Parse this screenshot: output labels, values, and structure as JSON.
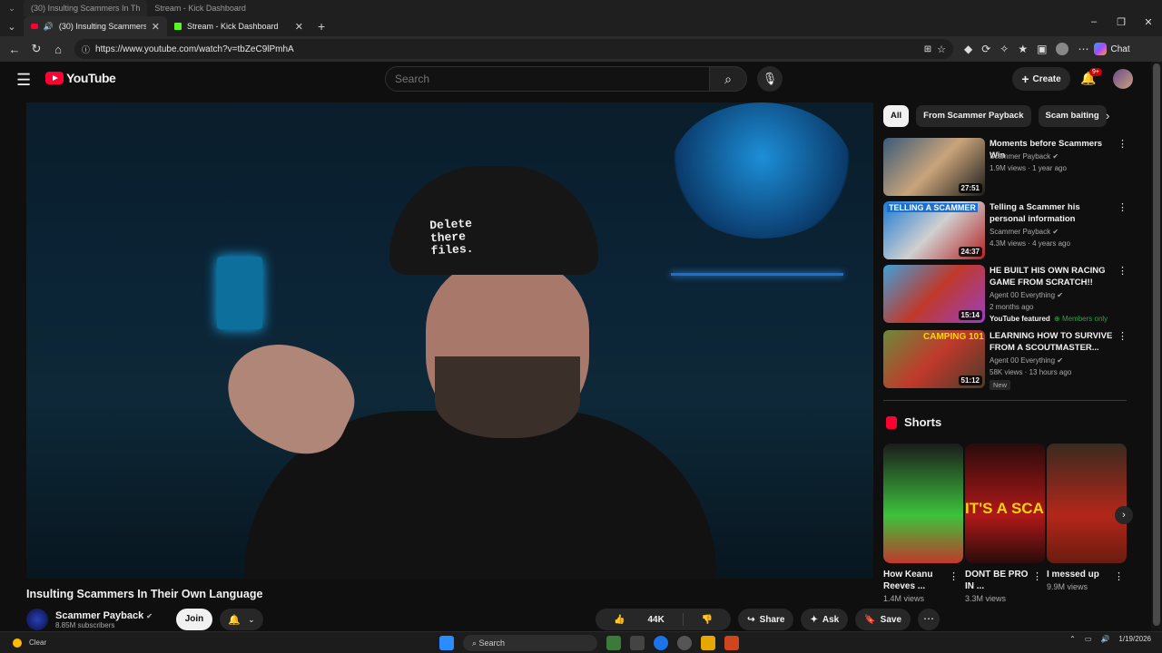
{
  "browser": {
    "tabs": [
      {
        "label": "(30) Insulting Scammers In Th"
      },
      {
        "label": "Stream - Kick Dashboard"
      }
    ],
    "url": "https://www.youtube.com/watch?v=tbZeC9lPmhA",
    "chat_label": "Chat"
  },
  "youtube": {
    "logo_text": "YouTube",
    "search_placeholder": "Search",
    "create_label": "Create",
    "notif_badge": "9+"
  },
  "video": {
    "title": "Insulting Scammers In Their Own Language",
    "hat_text": "Delete\nthere\nfiles.",
    "channel": {
      "name": "Scammer Payback",
      "subscribers": "8.85M subscribers"
    },
    "join_label": "Join",
    "like_count": "44K",
    "share_label": "Share",
    "ask_label": "Ask",
    "save_label": "Save"
  },
  "chips": [
    "All",
    "From Scammer Payback",
    "Scam baiting"
  ],
  "recommendations": [
    {
      "title": "Moments before Scammers Win",
      "channel": "Scammer Payback",
      "meta": "1.9M views · 1 year ago",
      "duration": "27:51"
    },
    {
      "title": "Telling a Scammer his personal information",
      "channel": "Scammer Payback",
      "meta": "4.3M views · 4 years ago",
      "duration": "24:37",
      "thumb_text": "TELLING A SCAMMER"
    },
    {
      "title": "HE BUILT HIS OWN RACING GAME FROM SCRATCH!!",
      "channel": "Agent 00 Everything",
      "meta": "2 months ago",
      "duration": "15:14",
      "featured": "YouTube featured",
      "members": "Members only"
    },
    {
      "title": "LEARNING HOW TO SURVIVE FROM A SCOUTMASTER...",
      "channel": "Agent 00 Everything",
      "meta": "58K views · 13 hours ago",
      "duration": "51:12",
      "tag": "New",
      "thumb_text": "CAMPING 101"
    }
  ],
  "shorts": {
    "heading": "Shorts",
    "items": [
      {
        "title": "How Keanu Reeves ...",
        "views": "1.4M views"
      },
      {
        "title": "DONT BE PRO IN ...",
        "views": "3.3M views",
        "thumb_text": "IT'S A SCAM"
      },
      {
        "title": "I messed up",
        "views": "9.9M views"
      }
    ]
  },
  "taskbar": {
    "weather": "Clear",
    "search": "Search",
    "date": "1/19/2026"
  }
}
